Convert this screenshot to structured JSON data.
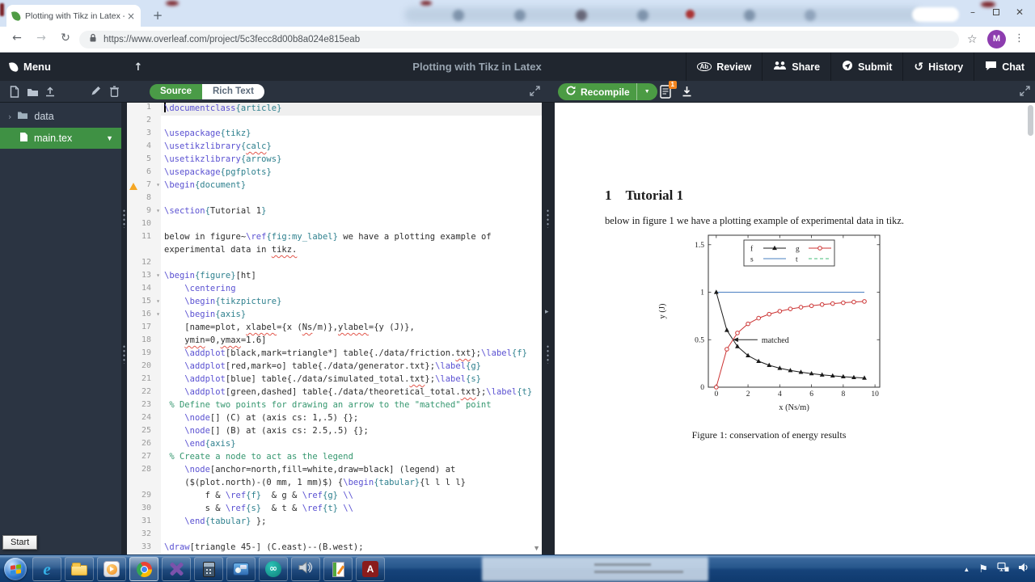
{
  "browser": {
    "tab_title": "Plotting with Tikz in Latex - Onlin",
    "url": "https://www.overleaf.com/project/5c3fecc8d00b8a024e815eab",
    "avatar_letter": "M"
  },
  "header": {
    "menu_label": "Menu",
    "title": "Plotting with Tikz in Latex",
    "review_icon_text": "Ab",
    "actions": [
      {
        "label": "Review"
      },
      {
        "label": "Share"
      },
      {
        "label": "Submit"
      },
      {
        "label": "History"
      },
      {
        "label": "Chat"
      }
    ]
  },
  "toolbar": {
    "source_label": "Source",
    "rich_text_label": "Rich Text",
    "recompile_label": "Recompile",
    "logs_badge": "1"
  },
  "file_tree": {
    "folder_label": "data",
    "file_label": "main.tex"
  },
  "editor": {
    "lines": [
      {
        "n": 1,
        "hl": 1,
        "cur": 1,
        "s": [
          [
            "c",
            "\\documentclass"
          ],
          [
            "a",
            "{article}"
          ]
        ]
      },
      {
        "n": 2,
        "s": []
      },
      {
        "n": 3,
        "s": [
          [
            "c",
            "\\usepackage"
          ],
          [
            "a",
            "{tikz}"
          ]
        ]
      },
      {
        "n": 4,
        "s": [
          [
            "c",
            "\\usetikzlibrary"
          ],
          [
            "a",
            "{"
          ],
          [
            "a",
            "calc",
            "1"
          ],
          [
            "a",
            "}"
          ]
        ]
      },
      {
        "n": 5,
        "s": [
          [
            "c",
            "\\usetikzlibrary"
          ],
          [
            "a",
            "{arrows}"
          ]
        ]
      },
      {
        "n": 6,
        "s": [
          [
            "c",
            "\\usepackage"
          ],
          [
            "a",
            "{pgfplots}"
          ]
        ]
      },
      {
        "n": 7,
        "warn": 1,
        "fold": 1,
        "s": [
          [
            "c",
            "\\begin"
          ],
          [
            "a",
            "{document}"
          ]
        ]
      },
      {
        "n": 8,
        "s": []
      },
      {
        "n": 9,
        "fold": 1,
        "s": [
          [
            "c",
            "\\section"
          ],
          [
            "a",
            "{"
          ],
          [
            "p",
            "Tutorial 1"
          ],
          [
            "a",
            "}"
          ]
        ]
      },
      {
        "n": 10,
        "s": []
      },
      {
        "n": 11,
        "s": [
          [
            "p",
            "below in figure~"
          ],
          [
            "c",
            "\\ref"
          ],
          [
            "a",
            "{fig:my_label}"
          ],
          [
            "p",
            " we have a plotting example of"
          ]
        ],
        "w": [
          [
            "p",
            "experimental data in "
          ],
          [
            "p",
            "tikz.",
            "1"
          ]
        ]
      },
      {
        "n": 12,
        "s": []
      },
      {
        "n": 13,
        "fold": 1,
        "s": [
          [
            "c",
            "\\begin"
          ],
          [
            "a",
            "{figure}"
          ],
          [
            "p",
            "[ht]"
          ]
        ]
      },
      {
        "n": 14,
        "s": [
          [
            "p",
            "    "
          ],
          [
            "c",
            "\\centering"
          ]
        ]
      },
      {
        "n": 15,
        "fold": 1,
        "s": [
          [
            "p",
            "    "
          ],
          [
            "c",
            "\\begin"
          ],
          [
            "a",
            "{tikzpicture}"
          ]
        ]
      },
      {
        "n": 16,
        "fold": 1,
        "s": [
          [
            "p",
            "    "
          ],
          [
            "c",
            "\\begin"
          ],
          [
            "a",
            "{axis}"
          ]
        ]
      },
      {
        "n": 17,
        "s": [
          [
            "p",
            "    [name=plot, "
          ],
          [
            "p",
            "xlabel",
            "1"
          ],
          [
            "p",
            "={x ("
          ],
          [
            "p",
            "Ns",
            "1"
          ],
          [
            "p",
            "/m)},"
          ],
          [
            "p",
            "ylabel",
            "1"
          ],
          [
            "p",
            "={y (J)},"
          ]
        ]
      },
      {
        "n": 18,
        "s": [
          [
            "p",
            "    "
          ],
          [
            "p",
            "ymin",
            "1"
          ],
          [
            "p",
            "=0,"
          ],
          [
            "p",
            "ymax",
            "1"
          ],
          [
            "p",
            "=1.6]"
          ]
        ]
      },
      {
        "n": 19,
        "s": [
          [
            "p",
            "    "
          ],
          [
            "c",
            "\\addplot"
          ],
          [
            "p",
            "[black,mark=triangle*] table{./data/friction."
          ],
          [
            "p",
            "txt",
            "1"
          ],
          [
            "p",
            "};"
          ],
          [
            "c",
            "\\label"
          ],
          [
            "a",
            "{f}"
          ]
        ]
      },
      {
        "n": 20,
        "s": [
          [
            "p",
            "    "
          ],
          [
            "c",
            "\\addplot"
          ],
          [
            "p",
            "[red,mark=o] table{./data/generator.txt};"
          ],
          [
            "c",
            "\\label"
          ],
          [
            "a",
            "{g}"
          ]
        ]
      },
      {
        "n": 21,
        "s": [
          [
            "p",
            "    "
          ],
          [
            "c",
            "\\addplot"
          ],
          [
            "p",
            "[blue] table{./data/simulated_total."
          ],
          [
            "p",
            "txt",
            "1"
          ],
          [
            "p",
            "};"
          ],
          [
            "c",
            "\\label"
          ],
          [
            "a",
            "{s}"
          ]
        ]
      },
      {
        "n": 22,
        "s": [
          [
            "p",
            "    "
          ],
          [
            "c",
            "\\addplot"
          ],
          [
            "p",
            "[green,dashed] table{./data/theoretical_total."
          ],
          [
            "p",
            "txt",
            "1"
          ],
          [
            "p",
            "};"
          ],
          [
            "c",
            "\\label"
          ],
          [
            "a",
            "{t}"
          ]
        ]
      },
      {
        "n": 23,
        "s": [
          [
            "m",
            " % Define two points for drawing an arrow to the \"matched\" point"
          ]
        ]
      },
      {
        "n": 24,
        "s": [
          [
            "p",
            "    "
          ],
          [
            "c",
            "\\node"
          ],
          [
            "p",
            "[] (C) at (axis cs: 1,.5) {};"
          ]
        ]
      },
      {
        "n": 25,
        "s": [
          [
            "p",
            "    "
          ],
          [
            "c",
            "\\node"
          ],
          [
            "p",
            "[] (B) at (axis cs: 2.5,.5) {};"
          ]
        ]
      },
      {
        "n": 26,
        "s": [
          [
            "p",
            "    "
          ],
          [
            "c",
            "\\end"
          ],
          [
            "a",
            "{axis}"
          ]
        ]
      },
      {
        "n": 27,
        "s": [
          [
            "m",
            " % Create a node to act as the legend"
          ]
        ]
      },
      {
        "n": 28,
        "s": [
          [
            "p",
            "    "
          ],
          [
            "c",
            "\\node"
          ],
          [
            "p",
            "[anchor=north,fill=white,draw=black] (legend) at"
          ]
        ],
        "w": [
          [
            "p",
            "    ($(plot.north)-(0 mm, 1 mm)$) {"
          ],
          [
            "c",
            "\\begin"
          ],
          [
            "a",
            "{tabular}"
          ],
          [
            "p",
            "{l l l l}"
          ]
        ]
      },
      {
        "n": 29,
        "s": [
          [
            "p",
            "        f & "
          ],
          [
            "c",
            "\\ref"
          ],
          [
            "a",
            "{f}"
          ],
          [
            "p",
            "  & g & "
          ],
          [
            "c",
            "\\ref"
          ],
          [
            "a",
            "{g}"
          ],
          [
            "c",
            " \\\\"
          ]
        ]
      },
      {
        "n": 30,
        "s": [
          [
            "p",
            "        s & "
          ],
          [
            "c",
            "\\ref"
          ],
          [
            "a",
            "{s}"
          ],
          [
            "p",
            "  & t & "
          ],
          [
            "c",
            "\\ref"
          ],
          [
            "a",
            "{t}"
          ],
          [
            "c",
            " \\\\"
          ]
        ]
      },
      {
        "n": 31,
        "s": [
          [
            "p",
            "    "
          ],
          [
            "c",
            "\\end"
          ],
          [
            "a",
            "{tabular}"
          ],
          [
            "p",
            " };"
          ]
        ]
      },
      {
        "n": 32,
        "s": []
      },
      {
        "n": 33,
        "s": [
          [
            "c",
            "\\draw"
          ],
          [
            "p",
            "[triangle 45-] (C.east)--(B.west);"
          ]
        ]
      }
    ]
  },
  "pdf": {
    "section_number": "1",
    "section_title": "Tutorial 1",
    "body_text": "below in figure 1 we have a plotting example of experimental data in tikz.",
    "caption": "Figure 1: conservation of energy results"
  },
  "chart_data": {
    "type": "line",
    "title": "",
    "xlabel": "x (Ns/m)",
    "ylabel": "y (J)",
    "xlim": [
      -0.5,
      10.3
    ],
    "ylim": [
      0,
      1.6
    ],
    "xticks": [
      0,
      2,
      4,
      6,
      8,
      10
    ],
    "yticks": [
      0,
      0.5,
      1,
      1.5
    ],
    "grid": false,
    "legend": {
      "position": "top-center",
      "rows": [
        [
          "f",
          "g"
        ],
        [
          "s",
          "t"
        ]
      ]
    },
    "annotation": {
      "text": "matched",
      "point": [
        1.05,
        0.5
      ],
      "text_at": [
        2.6,
        0.5
      ]
    },
    "series": [
      {
        "name": "t",
        "color": "#46bd7a",
        "style": "dashed",
        "marker": "none",
        "x": [
          0,
          9.333
        ],
        "y": [
          1,
          1
        ]
      },
      {
        "name": "s",
        "color": "#4a7fc1",
        "style": "solid",
        "marker": "none",
        "x": [
          0,
          9.333
        ],
        "y": [
          1,
          1
        ]
      },
      {
        "name": "f",
        "color": "#1a1a1a",
        "style": "solid",
        "marker": "triangle",
        "x": [
          0,
          0.667,
          1.333,
          2,
          2.667,
          3.333,
          4,
          4.667,
          5.333,
          6,
          6.667,
          7.333,
          8,
          8.667,
          9.333
        ],
        "y": [
          1,
          0.6,
          0.429,
          0.333,
          0.273,
          0.231,
          0.2,
          0.176,
          0.158,
          0.143,
          0.13,
          0.12,
          0.111,
          0.103,
          0.097
        ]
      },
      {
        "name": "g",
        "color": "#cc3333",
        "style": "solid",
        "marker": "circle",
        "x": [
          0,
          0.667,
          1.333,
          2,
          2.667,
          3.333,
          4,
          4.667,
          5.333,
          6,
          6.667,
          7.333,
          8,
          8.667,
          9.333
        ],
        "y": [
          0,
          0.4,
          0.571,
          0.667,
          0.727,
          0.769,
          0.8,
          0.824,
          0.842,
          0.857,
          0.87,
          0.88,
          0.889,
          0.897,
          0.903
        ]
      }
    ]
  },
  "taskbar": {
    "start_tooltip": "Start",
    "pinned": [
      "start",
      "internet-explorer",
      "windows-explorer",
      "windows-media-player",
      "chrome",
      "visual-studio",
      "calculator",
      "control-panel",
      "arduino",
      "volume",
      "journal",
      "acrobat"
    ]
  }
}
